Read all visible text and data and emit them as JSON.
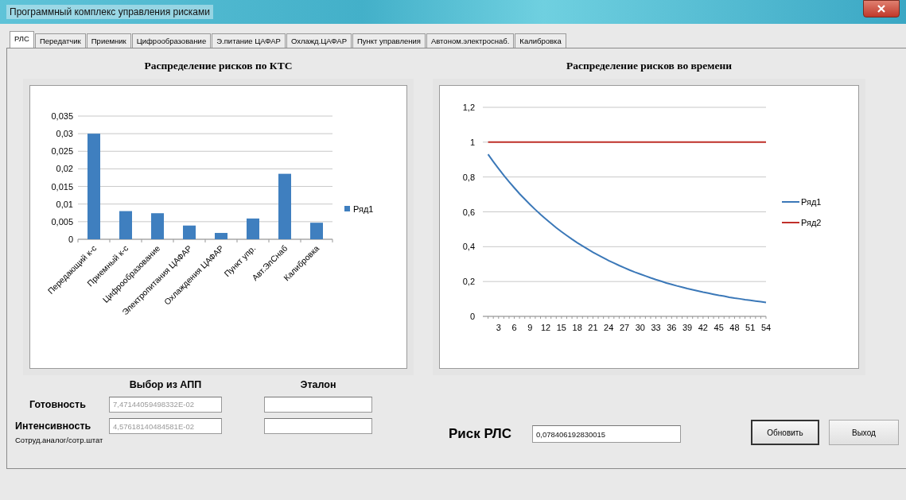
{
  "window": {
    "title": "Программный комплекс управления рисками"
  },
  "tabs": [
    {
      "label": "РЛС",
      "selected": true
    },
    {
      "label": "Передатчик",
      "selected": false
    },
    {
      "label": "Приемник",
      "selected": false
    },
    {
      "label": "Цифрообразование",
      "selected": false
    },
    {
      "label": "Э.питание ЦАФАР",
      "selected": false
    },
    {
      "label": "Охлажд.ЦАФАР",
      "selected": false
    },
    {
      "label": "Пункт управления",
      "selected": false
    },
    {
      "label": "Автоном.электроснаб.",
      "selected": false
    },
    {
      "label": "Калибровка",
      "selected": false
    }
  ],
  "left_panel": {
    "heading": "Распределение рисков по КТС",
    "chart_data": {
      "type": "bar",
      "categories": [
        "Передающий к-с",
        "Приемный к-с",
        "Цифрообразование",
        "Электропитания ЦАФАР",
        "Охлаждения ЦАФАР",
        "Пункт упр.",
        "Авт.ЭлСнаб",
        "Калибровка"
      ],
      "series": [
        {
          "name": "Ряд1",
          "color": "#3f7fbf",
          "values": [
            0.03,
            0.008,
            0.0074,
            0.0039,
            0.0018,
            0.0059,
            0.0186,
            0.0047
          ]
        }
      ],
      "ylim": [
        0,
        0.035
      ],
      "grid": true,
      "legend": "right",
      "yticks": [
        {
          "value": 0,
          "label": "0"
        },
        {
          "value": 0.005,
          "label": "0,005"
        },
        {
          "value": 0.01,
          "label": "0,01"
        },
        {
          "value": 0.015,
          "label": "0,015"
        },
        {
          "value": 0.02,
          "label": "0,02"
        },
        {
          "value": 0.025,
          "label": "0,025"
        },
        {
          "value": 0.03,
          "label": "0,03"
        },
        {
          "value": 0.035,
          "label": "0,035"
        }
      ]
    }
  },
  "right_panel": {
    "heading": "Распределение рисков во времени",
    "chart_data": {
      "type": "line",
      "x": [
        1,
        2,
        3,
        4,
        5,
        6,
        7,
        8,
        9,
        10,
        11,
        12,
        13,
        14,
        15,
        16,
        17,
        18,
        19,
        20,
        21,
        22,
        23,
        24,
        25,
        26,
        27,
        28,
        29,
        30,
        31,
        32,
        33,
        34,
        35,
        36,
        37,
        38,
        39,
        40,
        41,
        42,
        43,
        44,
        45,
        46,
        47,
        48,
        49,
        50,
        51,
        52,
        53,
        54
      ],
      "series": [
        {
          "name": "Ряд1",
          "color": "#3b78b8",
          "values": [
            0.93,
            0.888,
            0.848,
            0.809,
            0.773,
            0.738,
            0.704,
            0.673,
            0.642,
            0.613,
            0.585,
            0.559,
            0.534,
            0.509,
            0.486,
            0.464,
            0.443,
            0.423,
            0.404,
            0.386,
            0.368,
            0.352,
            0.336,
            0.32,
            0.306,
            0.292,
            0.279,
            0.266,
            0.254,
            0.243,
            0.232,
            0.221,
            0.211,
            0.202,
            0.192,
            0.184,
            0.175,
            0.168,
            0.16,
            0.153,
            0.146,
            0.139,
            0.133,
            0.127,
            0.121,
            0.116,
            0.11,
            0.105,
            0.101,
            0.096,
            0.092,
            0.088,
            0.084,
            0.08
          ]
        },
        {
          "name": "Ряд2",
          "color": "#c0302a",
          "values": [
            1,
            1,
            1,
            1,
            1,
            1,
            1,
            1,
            1,
            1,
            1,
            1,
            1,
            1,
            1,
            1,
            1,
            1,
            1,
            1,
            1,
            1,
            1,
            1,
            1,
            1,
            1,
            1,
            1,
            1,
            1,
            1,
            1,
            1,
            1,
            1,
            1,
            1,
            1,
            1,
            1,
            1,
            1,
            1,
            1,
            1,
            1,
            1,
            1,
            1,
            1,
            1,
            1,
            1
          ]
        }
      ],
      "xlim": [
        0,
        54
      ],
      "ylim": [
        0,
        1.2
      ],
      "grid": true,
      "legend": "right",
      "xticks": [
        3,
        6,
        9,
        12,
        15,
        18,
        21,
        24,
        27,
        30,
        33,
        36,
        39,
        42,
        45,
        48,
        51,
        54
      ],
      "yticks": [
        {
          "value": 0,
          "label": "0"
        },
        {
          "value": 0.2,
          "label": "0,2"
        },
        {
          "value": 0.4,
          "label": "0,4"
        },
        {
          "value": 0.6,
          "label": "0,6"
        },
        {
          "value": 0.8,
          "label": "0,8"
        },
        {
          "value": 1,
          "label": "1"
        },
        {
          "value": 1.2,
          "label": "1,2"
        }
      ]
    }
  },
  "form": {
    "column_headings": [
      "Выбор из АПП",
      "Эталон"
    ],
    "rows": [
      {
        "label": "Готовность",
        "value": "7,47144059498332E-02",
        "disabled": true
      },
      {
        "label": "Интенсивность",
        "value": "4,57618140484581E-02",
        "disabled": true,
        "note": "Сотруд.аналог/сотр.штат"
      }
    ],
    "risk": {
      "label": "Риск РЛС",
      "value": "0,078406192830015"
    }
  },
  "buttons": [
    {
      "label": "Обновить",
      "default": true
    },
    {
      "label": "Выход",
      "default": false
    }
  ]
}
